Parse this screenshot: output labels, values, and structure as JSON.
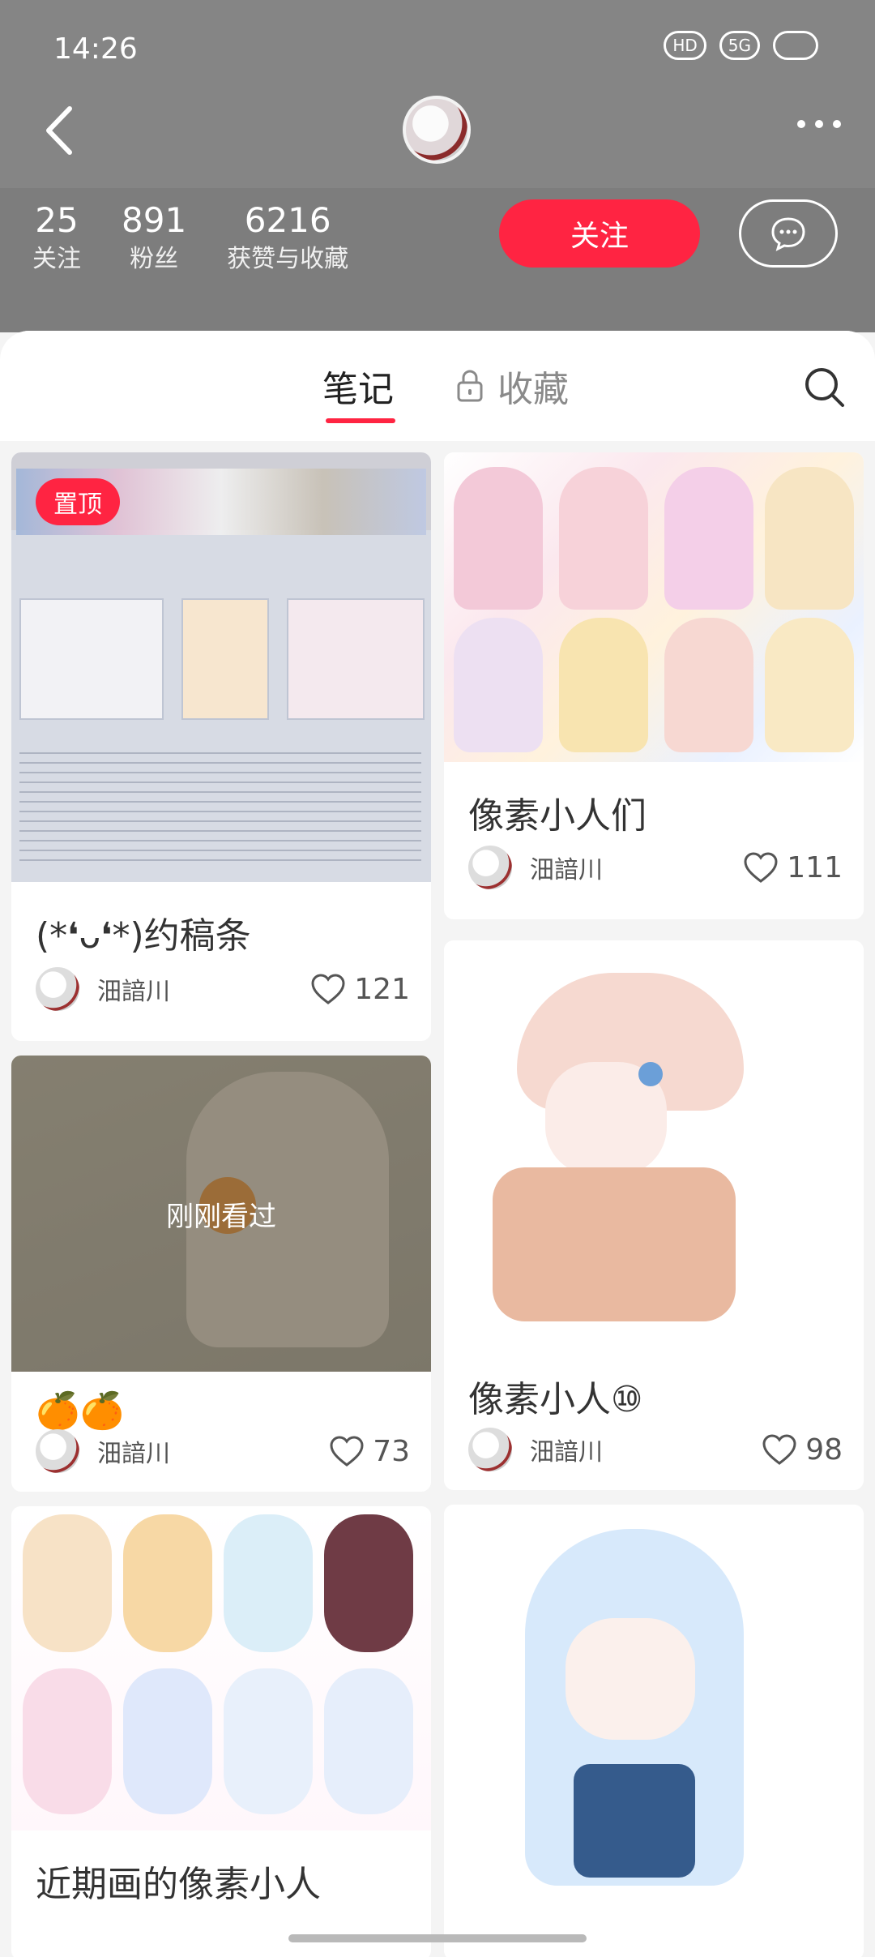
{
  "status_bar": {
    "time": "14:26",
    "icons": [
      "HD",
      "5G"
    ]
  },
  "header": {
    "stats": [
      {
        "num": "25",
        "label": "关注"
      },
      {
        "num": "891",
        "label": "粉丝"
      },
      {
        "num": "6216",
        "label": "获赞与收藏"
      }
    ],
    "follow_label": "关注"
  },
  "tabs": {
    "notes": "笔记",
    "collections": "收藏"
  },
  "cards": [
    {
      "title": "(*❛ᴗ❛*)约稿条",
      "author": "沺諳川",
      "likes": "121",
      "badge": "置顶"
    },
    {
      "title": "像素小人们",
      "author": "沺諳川",
      "likes": "111"
    },
    {
      "title": "🍊🍊",
      "author": "沺諳川",
      "likes": "73",
      "overlay": "刚刚看过"
    },
    {
      "title": "像素小人⑩",
      "author": "沺諳川",
      "likes": "98"
    },
    {
      "title": "近期画的像素小人",
      "author": "沺諳川",
      "likes": ""
    },
    {
      "title": "",
      "author": "",
      "likes": ""
    }
  ],
  "colors": {
    "accent": "#ff2442",
    "header_bg": "#808080"
  }
}
